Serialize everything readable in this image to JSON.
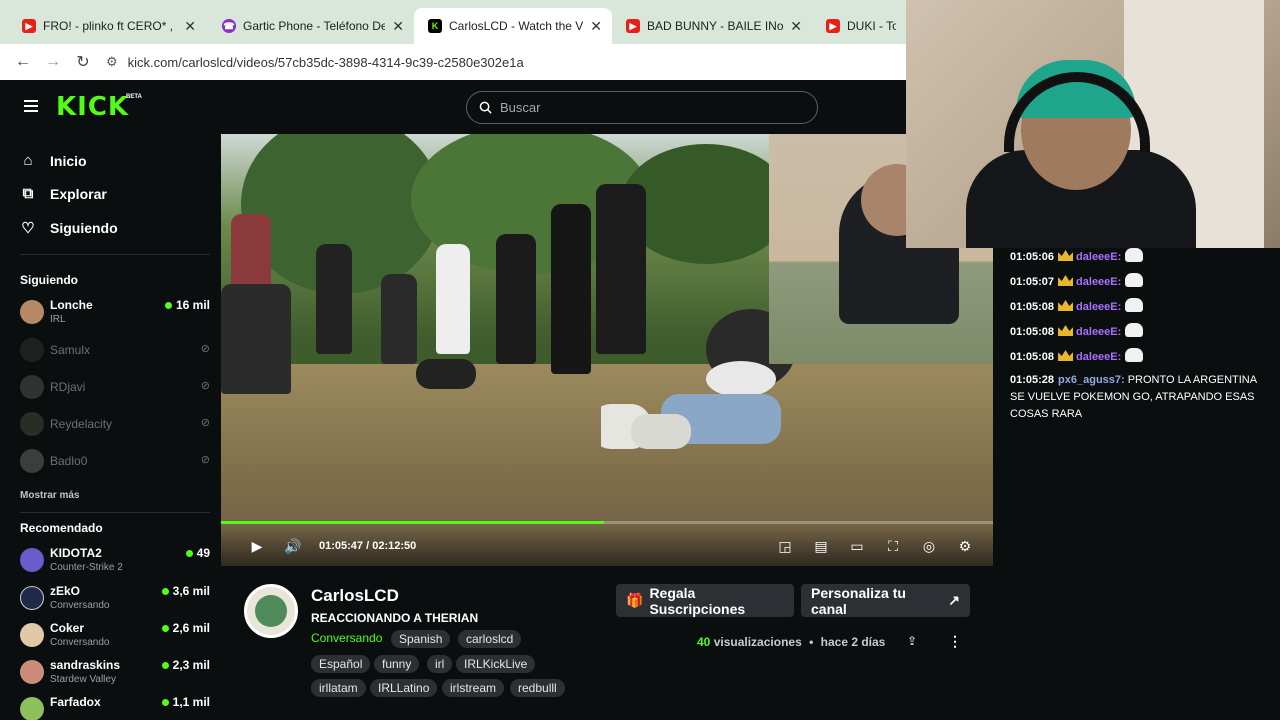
{
  "browser": {
    "tabs": [
      {
        "title": "FRO! - plinko ft CERO* , CLUSTE",
        "icon": "youtube-icon"
      },
      {
        "title": "Gartic Phone - Teléfono Descom",
        "icon": "gartic-icon"
      },
      {
        "title": "CarlosLCD - Watch the VOD on",
        "icon": "kick-icon"
      },
      {
        "title": "BAD BUNNY - BAILE INoLVIDAB",
        "icon": "youtube-icon"
      },
      {
        "title": "DUKI - Toc Psy",
        "icon": "youtube-icon"
      }
    ],
    "close_glyph": "✕",
    "url": "kick.com/carloslcd/videos/57cb35dc-3898-4314-9c39-c2580e302e1a"
  },
  "header": {
    "logo": "KICK",
    "beta": "BETA",
    "search_placeholder": "Buscar"
  },
  "sidebar": {
    "nav": [
      {
        "label": "Inicio",
        "icon": "home-icon"
      },
      {
        "label": "Explorar",
        "icon": "compass-icon"
      },
      {
        "label": "Siguiendo",
        "icon": "heart-icon"
      }
    ],
    "following_header": "Siguiendo",
    "following": [
      {
        "name": "Lonche",
        "category": "IRL",
        "viewers": "16 mil",
        "live": true
      },
      {
        "name": "Samulx",
        "live": false
      },
      {
        "name": "RDjavi",
        "live": false
      },
      {
        "name": "Reydelacity",
        "live": false
      },
      {
        "name": "Badlo0",
        "live": false
      }
    ],
    "show_more": "Mostrar más",
    "recommended_header": "Recomendado",
    "recommended": [
      {
        "name": "KIDOTA2",
        "category": "Counter-Strike 2",
        "viewers": "49"
      },
      {
        "name": "zEkO",
        "category": "Conversando",
        "viewers": "3,6 mil"
      },
      {
        "name": "Coker",
        "category": "Conversando",
        "viewers": "2,6 mil"
      },
      {
        "name": "sandraskins",
        "category": "Stardew Valley",
        "viewers": "2,3 mil"
      },
      {
        "name": "Farfadox",
        "category": "",
        "viewers": "1,1 mil"
      }
    ]
  },
  "player": {
    "current_time": "01:05:47",
    "separator": "/",
    "duration": "02:12:50",
    "progress": 0.496
  },
  "channel": {
    "name": "CarlosLCD",
    "video_title": "REACCIONANDO A THERIAN",
    "category": "Conversando",
    "tags_row1": [
      "Spanish",
      "carloslcd"
    ],
    "tags_row2": [
      "Español",
      "funny",
      "irl",
      "IRLKickLive"
    ],
    "tags_row3": [
      "irllatam",
      "IRLLatino",
      "irlstream",
      "redbulll"
    ],
    "gift_button": "Regala Suscripciones",
    "customize_button": "Personaliza tu canal",
    "views_count": "40",
    "views_label": "visualizaciones",
    "dot": "•",
    "posted": "hace 2 días"
  },
  "chat": {
    "messages": [
      {
        "time": "01:05:06",
        "user": "daleeeE:",
        "user_color": "#a970ff",
        "badge": true,
        "emote": true,
        "text": ""
      },
      {
        "time": "01:05:07",
        "user": "daleeeE:",
        "user_color": "#a970ff",
        "badge": true,
        "emote": true,
        "text": ""
      },
      {
        "time": "01:05:08",
        "user": "daleeeE:",
        "user_color": "#a970ff",
        "badge": true,
        "emote": true,
        "text": ""
      },
      {
        "time": "01:05:08",
        "user": "daleeeE:",
        "user_color": "#a970ff",
        "badge": true,
        "emote": true,
        "text": ""
      },
      {
        "time": "01:05:08",
        "user": "daleeeE:",
        "user_color": "#a970ff",
        "badge": true,
        "emote": true,
        "text": ""
      },
      {
        "time": "01:05:28",
        "user": "px6_aguss7:",
        "user_color": "#93a9e8",
        "badge": false,
        "emote": false,
        "text": "PRONTO LA ARGENTINA SE VUELVE POKEMON GO, ATRAPANDO ESAS COSAS RARA"
      }
    ]
  },
  "colors": {
    "accent": "#53fc18",
    "background": "#0b0e0f",
    "chip": "#2c2f34"
  }
}
